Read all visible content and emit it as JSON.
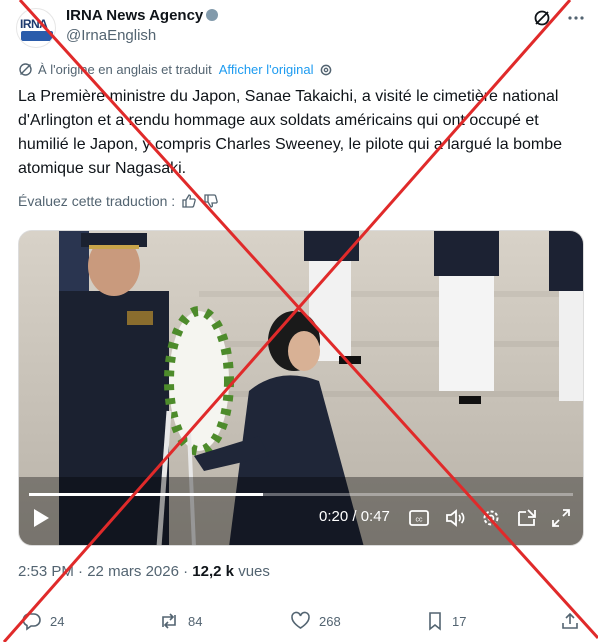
{
  "account": {
    "logo_text": "IRNA",
    "logo_sub": "ENGLISH",
    "display_name": "IRNA News Agency",
    "handle": "@IrnaEnglish"
  },
  "header_icons": [
    "grok-icon",
    "more-icon"
  ],
  "translation": {
    "note": "À l'origine en anglais et traduit",
    "show_original": "Afficher l'original"
  },
  "tweet_text": "La Première ministre du Japon, Sanae Takaichi, a visité le cimetière national d'Arlington et a rendu hommage aux soldats américains qui ont occupé et humilié le Japon, y compris Charles Sweeney, le pilote qui a largué la bombe atomique sur Nagasaki.",
  "rate_translation": "Évaluez cette traduction :",
  "video": {
    "current_time": "0:20",
    "duration": "0:47",
    "time_display": "0:20 / 0:47",
    "progress": 0.43
  },
  "meta": {
    "time": "2:53 PM",
    "date": "22 mars 2026",
    "views_count": "12,2 k",
    "views_label": "vues"
  },
  "actions": {
    "replies": "24",
    "reposts": "84",
    "likes": "268",
    "bookmarks": "17"
  },
  "colors": {
    "text": "#0f1419",
    "muted": "#536471",
    "link": "#1d9bf0",
    "cross": "#e02a2a"
  }
}
